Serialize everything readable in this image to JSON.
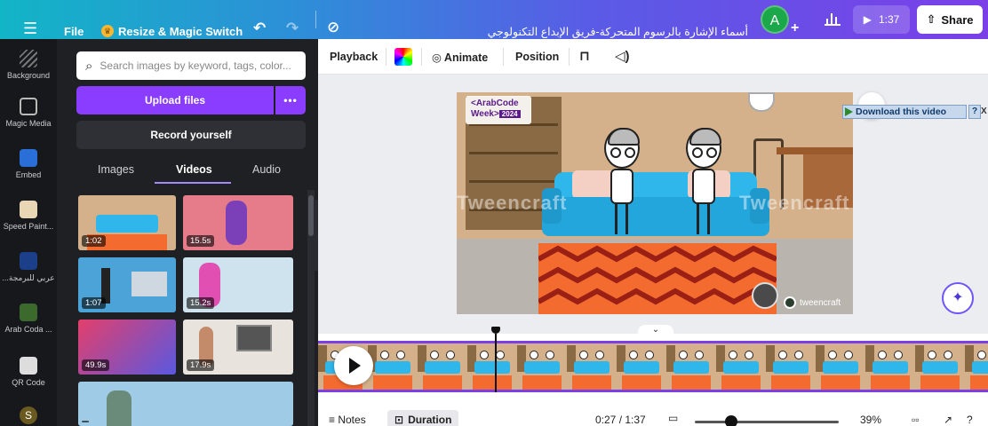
{
  "topbar": {
    "menu_icon": "hamburger-icon",
    "file_label": "File",
    "resize_label": "Resize & Magic Switch",
    "design_title": "أسماء الإشارة بالرسوم المتحركة-فريق الإبداع التكنولوجي",
    "avatar_letter": "A",
    "play_time": "1:37",
    "share_label": "Share"
  },
  "rail": {
    "items": [
      {
        "label": "Background",
        "icon": "background-icon"
      },
      {
        "label": "Magic Media",
        "icon": "magic-media-icon"
      },
      {
        "label": "Embed",
        "icon": "embed-icon"
      },
      {
        "label": "Speed Paint...",
        "icon": "speed-paint-icon"
      },
      {
        "label": "...عربي للبرمجة",
        "icon": "app-icon"
      },
      {
        "label": "Arab Coda ...",
        "icon": "arab-code-icon"
      },
      {
        "label": "QR Code",
        "icon": "qr-code-icon"
      },
      {
        "label": "S",
        "icon": "app-s-icon"
      }
    ]
  },
  "panel": {
    "search_placeholder": "Search images by keyword, tags, color...",
    "upload_label": "Upload files",
    "upload_more": "•••",
    "record_label": "Record yourself",
    "tabs": [
      {
        "label": "Images",
        "active": false
      },
      {
        "label": "Videos",
        "active": true
      },
      {
        "label": "Audio",
        "active": false
      }
    ],
    "thumbnails": [
      {
        "duration": "1:02"
      },
      {
        "duration": "15.5s"
      },
      {
        "duration": "1:07"
      },
      {
        "duration": "15.2s"
      },
      {
        "duration": "49.9s"
      },
      {
        "duration": "17.9s"
      },
      {
        "duration": ""
      }
    ]
  },
  "editor_toolbar": {
    "playback": "Playback",
    "animate": "Animate",
    "position": "Position"
  },
  "canvas": {
    "badge_line1": "<ArabCode",
    "badge_line2": "Week>",
    "badge_year": "2024",
    "watermark": "Tweencraft",
    "logo_text": "tweencraft",
    "download_label": "Download this video",
    "download_help": "?",
    "download_close": "X"
  },
  "bottombar": {
    "notes": "Notes",
    "duration": "Duration",
    "timecode": "0:27 / 1:37",
    "zoom": "39%",
    "zoom_fraction": 0.25,
    "help": "?"
  },
  "colors": {
    "accent": "#8b3dff",
    "timeline_border": "#7b3fe8",
    "panel_bg": "#1f2024",
    "rail_bg": "#17181c"
  }
}
